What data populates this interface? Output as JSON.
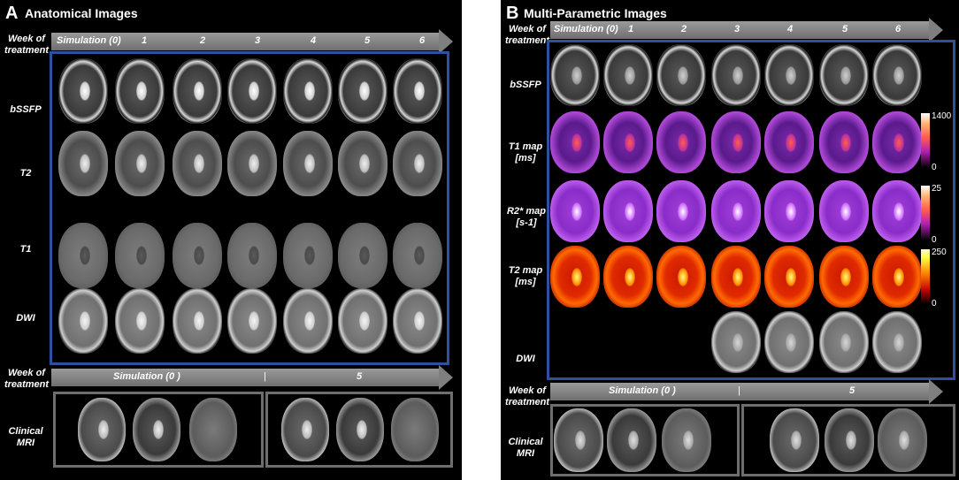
{
  "panelA": {
    "letter": "A",
    "title": "Anatomical Images",
    "week_label": "Week of\ntreatment",
    "weeks": [
      "Simulation (0)",
      "1",
      "2",
      "3",
      "4",
      "5",
      "6"
    ],
    "rows": [
      "bSSFP",
      "T2",
      "T1",
      "DWI"
    ],
    "week_label_bottom": "Week of\ntreatment",
    "bottom_weeks": [
      "Simulation (0 )",
      "|",
      "5"
    ],
    "clinical_label": "Clinical\nMRI"
  },
  "panelB": {
    "letter": "B",
    "title": "Multi-Parametric Images",
    "week_label": "Week of\ntreatment",
    "weeks": [
      "Simulation (0)",
      "1",
      "2",
      "3",
      "4",
      "5",
      "6"
    ],
    "rows": [
      "bSSFP",
      "T1 map\n[ms]",
      "R2* map\n[s-1]",
      "T2 map\n[ms]",
      "DWI"
    ],
    "colorbars": [
      {
        "max": "1400",
        "min": "0"
      },
      {
        "max": "25",
        "min": "0"
      },
      {
        "max": "250",
        "min": "0"
      }
    ],
    "week_label_bottom": "Week of\ntreatment",
    "bottom_weeks": [
      "Simulation (0 )",
      "|",
      "5"
    ],
    "clinical_label": "Clinical\nMRI"
  },
  "colors": {
    "blue_frame": "#2f4f9f",
    "gray_frame": "#6e6e6e",
    "arrow": "#8a8a8a"
  }
}
